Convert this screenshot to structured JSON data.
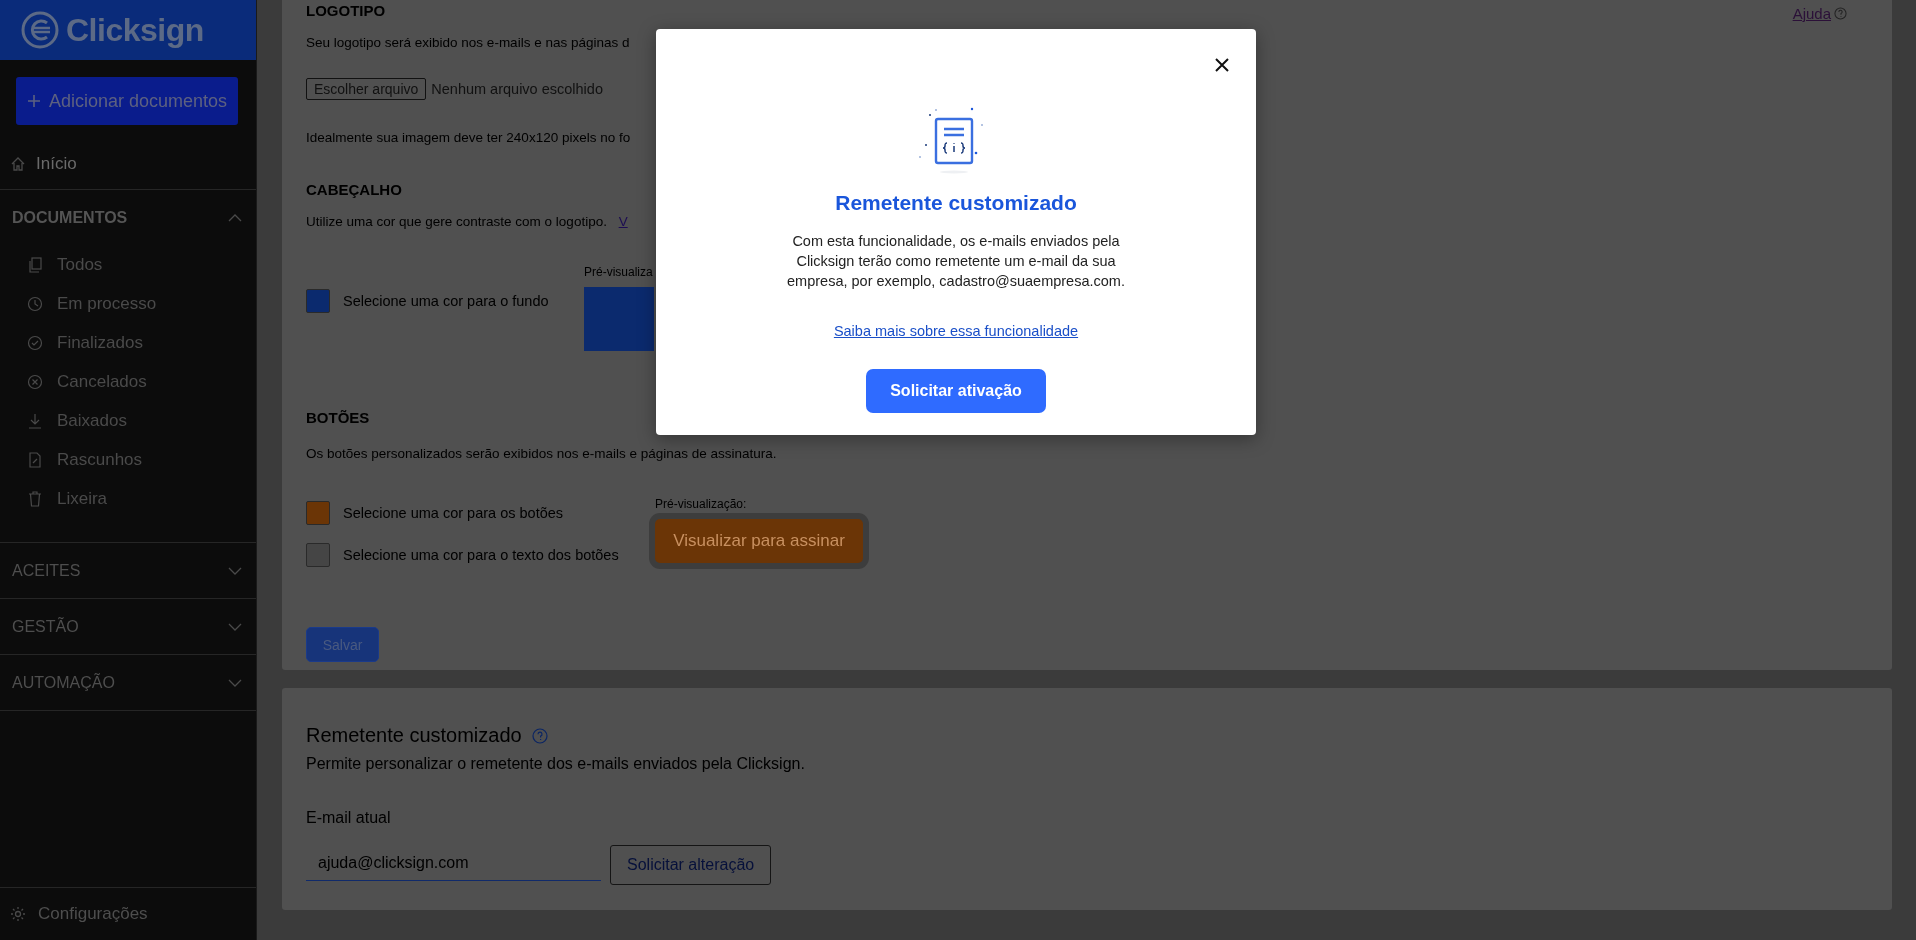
{
  "sidebar": {
    "logo": "Clicksign",
    "add_button": "Adicionar documentos",
    "home": "Início",
    "sections": [
      {
        "label": "DOCUMENTOS",
        "expanded": true,
        "items": [
          "Todos",
          "Em processo",
          "Finalizados",
          "Cancelados",
          "Baixados",
          "Rascunhos",
          "Lixeira"
        ]
      },
      {
        "label": "ACEITES",
        "expanded": false
      },
      {
        "label": "GESTÃO",
        "expanded": false
      },
      {
        "label": "AUTOMAÇÃO",
        "expanded": false
      }
    ],
    "footer": "Configurações"
  },
  "help_link": "Ajuda",
  "appearance": {
    "logo": {
      "heading": "LOGOTIPO",
      "description": "Seu logotipo será exibido nos e-mails e nas páginas d",
      "file_button": "Escolher arquivo",
      "file_status": "Nenhum arquivo escolhido",
      "hint": "Idealmente sua imagem deve ter 240x120 pixels no fo"
    },
    "header": {
      "heading": "CABEÇALHO",
      "description": "Utilize uma cor que gere contraste com o logotipo.",
      "link": "V",
      "preview_label": "Pré-visualiza",
      "colors": [
        {
          "label": "Selecione uma cor para o fundo",
          "color": "#0b2a6e"
        }
      ]
    },
    "buttons": {
      "heading": "BOTÕES",
      "description": "Os botões personalizados serão exibidos nos e-mails e páginas de assinatura.",
      "colors": [
        {
          "label": "Selecione uma cor para os botões",
          "color": "#6b3506"
        },
        {
          "label": "Selecione uma cor para o texto dos botões",
          "color": "#454545"
        }
      ],
      "preview_label": "Pré-visualização:",
      "preview_button": "Visualizar para assinar"
    },
    "save_button": "Salvar"
  },
  "sender": {
    "title": "Remetente customizado",
    "description": "Permite personalizar o remetente dos e-mails enviados pela Clicksign.",
    "email_label": "E-mail atual",
    "email_value": "ajuda@clicksign.com",
    "change_button": "Solicitar alteração"
  },
  "modal": {
    "title": "Remetente customizado",
    "body": "Com esta funcionalidade, os e-mails enviados pela Clicksign terão como remetente um e-mail da sua empresa, por exemplo, cadastro@suaempresa.com.",
    "link": "Saiba mais sobre essa funcionalidade",
    "button": "Solicitar ativação"
  }
}
